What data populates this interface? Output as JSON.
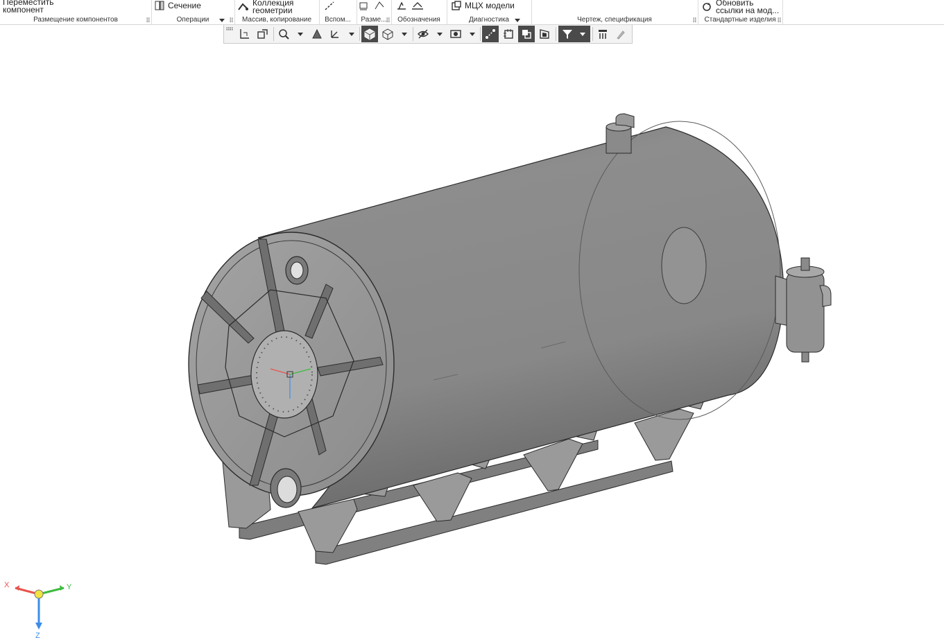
{
  "ribbon": {
    "groups": [
      {
        "caption": "Размещение компонентов",
        "tool_label_1": "Переместить",
        "tool_label_2": "компонент"
      },
      {
        "caption": "Операции",
        "tool_label": "Сечение"
      },
      {
        "caption": "Массив, копирование",
        "tool_label_1": "Коллекция",
        "tool_label_2": "геометрии"
      },
      {
        "caption": "Вспом..."
      },
      {
        "caption": "Разме..."
      },
      {
        "caption": "Обозначения"
      },
      {
        "caption": "Диагностика",
        "tool_label": "МЦХ модели"
      },
      {
        "caption": "Чертеж, спецификация"
      },
      {
        "caption": "Стандартные изделия",
        "tool_label_1": "Обновить",
        "tool_label_2": "ссылки на мод..."
      }
    ]
  },
  "viewbar": {
    "buttons": [
      "select-filter-icon",
      "component-select-icon",
      "zoom-icon",
      "orient-icon",
      "axis-icon",
      "shaded-edges-icon",
      "wireframe-icon",
      "hide-icon",
      "visibility-icon",
      "show-axes-icon",
      "sketch-icon",
      "section-view-icon",
      "perspective-icon",
      "filter-icon",
      "properties-icon",
      "paint-icon"
    ]
  },
  "triad": {
    "x_label": "X",
    "y_label": "Y",
    "z_label": "Z"
  },
  "colors": {
    "triad_x": "#e8534a",
    "triad_y": "#3dbb3d",
    "triad_z": "#3c8de8",
    "model_fill": "#8c8c8c",
    "model_edge": "#2b2b2b"
  }
}
